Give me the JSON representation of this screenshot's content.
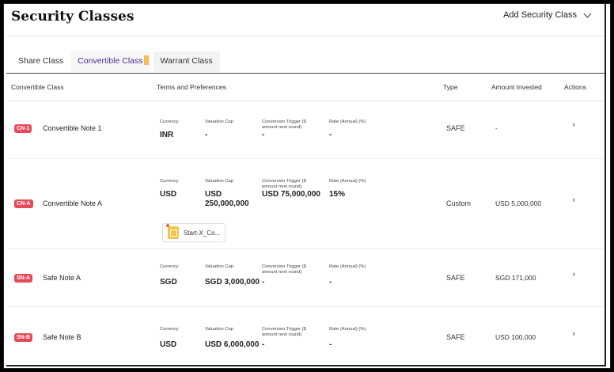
{
  "header": {
    "title": "Security Classes",
    "add_label": "Add Security Class"
  },
  "tabs": [
    {
      "label": "Share Class"
    },
    {
      "label": "Convertible Class"
    },
    {
      "label": "Warrant Class"
    }
  ],
  "table": {
    "columns": {
      "convertible_class": "Convertible Class",
      "terms": "Terms and Preferences",
      "type": "Type",
      "amount": "Amount Invested",
      "actions": "Actions"
    },
    "term_labels": {
      "currency": "Currency",
      "valuation_cap": "Valuation Cap",
      "conversion_trigger": "Conversion Trigger ($ amount next round)",
      "rate": "Rate (Annual) (%)"
    },
    "rows": [
      {
        "badge": "CN-1",
        "name": "Convertible Note 1",
        "currency": "INR",
        "valuation_cap": "-",
        "conversion_trigger": "-",
        "rate": "-",
        "type": "SAFE",
        "amount": "-"
      },
      {
        "badge": "CN-A",
        "name": "Convertible Note A",
        "currency": "USD",
        "valuation_cap": "USD 250,000,000",
        "conversion_trigger": "USD 75,000,000",
        "rate": "15%",
        "type": "Custom",
        "amount": "USD 5,000,000",
        "attachment": "Start-X_Co..."
      },
      {
        "badge": "SN-A",
        "name": "Safe Note A",
        "currency": "SGD",
        "valuation_cap": "SGD 3,000,000",
        "conversion_trigger": "-",
        "rate": "-",
        "type": "SAFE",
        "amount": "SGD 171,000"
      },
      {
        "badge": "SN-B",
        "name": "Safe Note B",
        "currency": "USD",
        "valuation_cap": "USD 6,000,000",
        "conversion_trigger": "-",
        "rate": "-",
        "type": "SAFE",
        "amount": "USD 100,000"
      }
    ]
  },
  "icons": {
    "actions": "kebab-menu-icon",
    "dropdown": "chevron-down-icon",
    "file": "document-icon"
  },
  "colors": {
    "badge": "#e64a5a",
    "active_tab": "#4b2a8a",
    "file_icon": "#f6c24a"
  }
}
